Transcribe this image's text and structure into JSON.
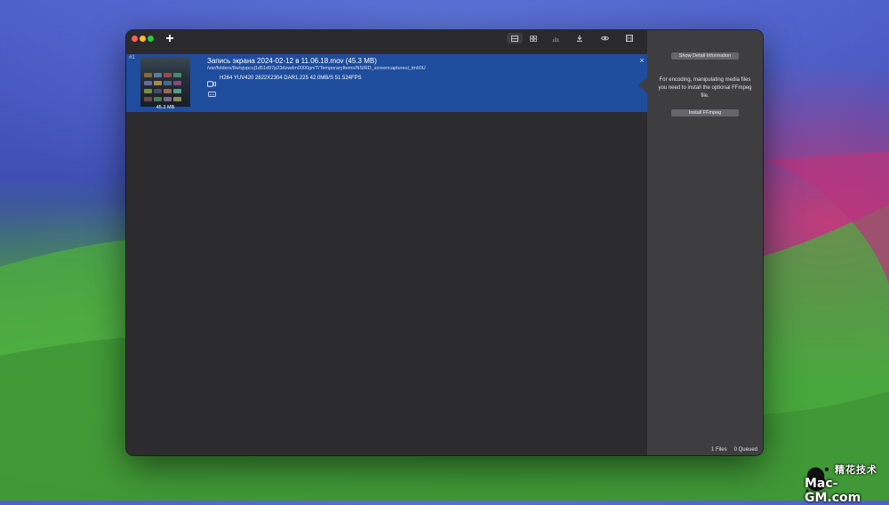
{
  "toolbar": {
    "add_label": "+",
    "icons": [
      "list-view-icon",
      "grid-view-icon",
      "chart-icon",
      "download-icon",
      "eye-icon",
      "film-icon"
    ]
  },
  "file": {
    "index": "#1",
    "title": "Запись экрана 2024-02-12 в 11.06.18.mov  (45.3 MB)",
    "path": "/var/folders/8w/sjvpcvj1d51d97p23dzwdm0000gn/T/TemporaryItems/NSIRD_screencaptureui_tmlI0U",
    "video_info": "H264 YUV420 2822X2304 DAR1.225 42.0MB/S 51.524FPS",
    "thumb_size": "45.3 MB",
    "close_label": "×"
  },
  "side_panel": {
    "detail_button": "Show Detail Information",
    "message": "For encoding, manipulating media files you need to install the optional FFmpeg file.",
    "install_button": "Install FFmpeg"
  },
  "status": {
    "files": "1 Files",
    "queued": "0 Queued"
  },
  "watermark": {
    "top": "精花技术",
    "bottom": "Mac-GM.com"
  },
  "colors": {
    "row_selected": "#1f4d9d",
    "side_panel": "#3e3e40",
    "window_bg": "#2c2c2e"
  }
}
